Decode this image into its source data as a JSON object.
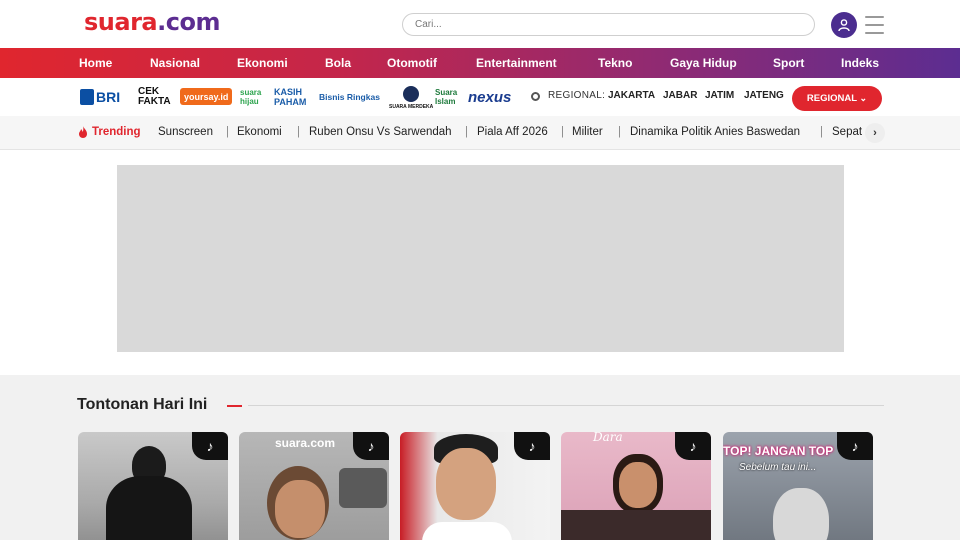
{
  "header": {
    "logo_part1": "suara",
    "logo_part2": ".com",
    "search_placeholder": "Cari..."
  },
  "nav": {
    "items": [
      "Home",
      "Nasional",
      "Ekonomi",
      "Bola",
      "Otomotif",
      "Entertainment",
      "Tekno",
      "Gaya Hidup",
      "Sport",
      "Indeks"
    ]
  },
  "partners": {
    "items": [
      "BRI",
      "CEK FAKTA",
      "yoursay.id",
      "suara hijau",
      "KASIH PAHAM",
      "Bisnis Ringkas",
      "SUARA MERDEKA",
      "Suara Islam",
      "nexus"
    ],
    "regional_label": "REGIONAL:",
    "regions": [
      "JAKARTA",
      "JABAR",
      "JATIM",
      "JATENG"
    ],
    "regional_button": "REGIONAL"
  },
  "trending": {
    "label": "Trending",
    "items": [
      "Sunscreen",
      "Ekonomi",
      "Ruben Onsu Vs Sarwendah",
      "Piala Aff 2026",
      "Militer",
      "Dinamika Politik Anies Baswedan",
      "Sepat"
    ],
    "next_icon": "›"
  },
  "watch": {
    "title": "Tontonan Hari Ini",
    "cards": [
      {
        "overlay": ""
      },
      {
        "overlay": "suara.com"
      },
      {
        "overlay": ""
      },
      {
        "overlay": "Dara"
      },
      {
        "overlay": "TOP! JANGAN TOP",
        "overlay2": "Sebelum tau ini..."
      }
    ]
  },
  "colors": {
    "brand_red": "#e0262e",
    "brand_purple": "#5c2d91"
  }
}
